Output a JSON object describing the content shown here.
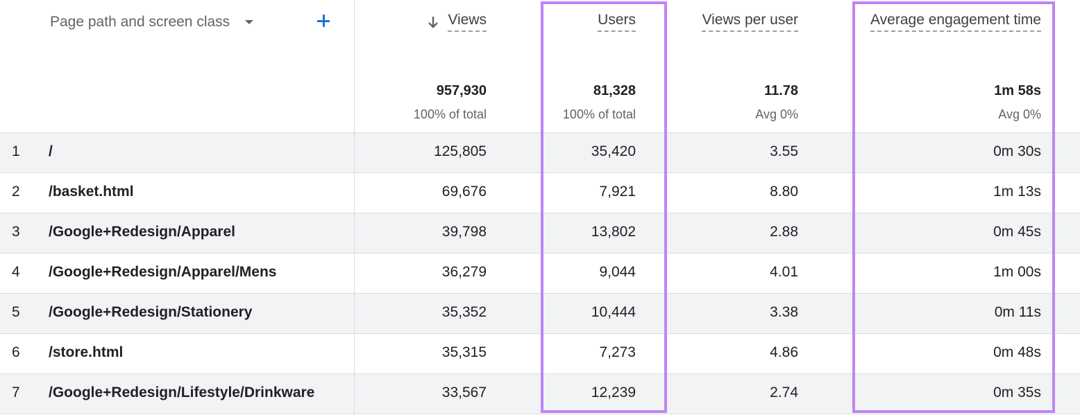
{
  "dimension": {
    "label": "Page path and screen class"
  },
  "columns": [
    {
      "key": "views",
      "label": "Views",
      "sorted": true,
      "total": "957,930",
      "sub": "100% of total"
    },
    {
      "key": "users",
      "label": "Users",
      "total": "81,328",
      "sub": "100% of total"
    },
    {
      "key": "vpu",
      "label": "Views per user",
      "total": "11.78",
      "sub": "Avg 0%"
    },
    {
      "key": "aet",
      "label": "Average engagement time",
      "total": "1m 58s",
      "sub": "Avg 0%"
    }
  ],
  "rows": [
    {
      "idx": "1",
      "path": "/",
      "views": "125,805",
      "users": "35,420",
      "vpu": "3.55",
      "aet": "0m 30s"
    },
    {
      "idx": "2",
      "path": "/basket.html",
      "views": "69,676",
      "users": "7,921",
      "vpu": "8.80",
      "aet": "1m 13s"
    },
    {
      "idx": "3",
      "path": "/Google+Redesign/Apparel",
      "views": "39,798",
      "users": "13,802",
      "vpu": "2.88",
      "aet": "0m 45s"
    },
    {
      "idx": "4",
      "path": "/Google+Redesign/Apparel/Mens",
      "views": "36,279",
      "users": "9,044",
      "vpu": "4.01",
      "aet": "1m 00s"
    },
    {
      "idx": "5",
      "path": "/Google+Redesign/Stationery",
      "views": "35,352",
      "users": "10,444",
      "vpu": "3.38",
      "aet": "0m 11s"
    },
    {
      "idx": "6",
      "path": "/store.html",
      "views": "35,315",
      "users": "7,273",
      "vpu": "4.86",
      "aet": "0m 48s"
    },
    {
      "idx": "7",
      "path": "/Google+Redesign/Lifestyle/Drinkware",
      "views": "33,567",
      "users": "12,239",
      "vpu": "2.74",
      "aet": "0m 35s"
    }
  ],
  "colors": {
    "highlight": "#c084f5",
    "accent": "#1a73e8",
    "row_shade": "#f1f3f4"
  },
  "icons": {
    "sort": "arrow-down-icon",
    "add": "plus-icon",
    "dropdown": "caret-down-icon"
  }
}
